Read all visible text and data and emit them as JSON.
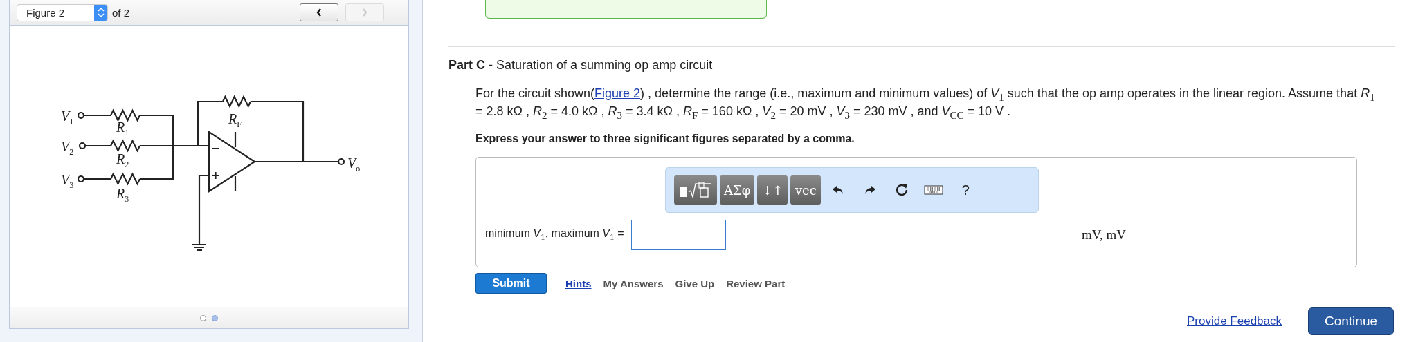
{
  "figure_nav": {
    "select_value": "Figure 2",
    "count": "of 2",
    "prev_disabled": false,
    "next_disabled": true
  },
  "circuit": {
    "labels": [
      {
        "base": "V",
        "sub": "1"
      },
      {
        "base": "V",
        "sub": "2"
      },
      {
        "base": "V",
        "sub": "3"
      },
      {
        "base": "R",
        "sub": "1"
      },
      {
        "base": "R",
        "sub": "2"
      },
      {
        "base": "R",
        "sub": "3"
      },
      {
        "base": "R",
        "sub": "F"
      },
      {
        "base": "V",
        "sub": "o"
      }
    ]
  },
  "pager": [
    {
      "selected": false
    },
    {
      "selected": true
    }
  ],
  "part": {
    "label": "Part C -",
    "title": "Saturation of a summing op amp circuit"
  },
  "problem": {
    "before_link": "For the circuit shown(",
    "link": "Figure 2",
    "after_link": ") , determine the range (i.e., maximum and minimum values) of *V*$_{1}$ such that the op amp operates in the linear region. Assume that *R*$_{1}$ = 2.8 kΩ , *R*$_{2}$ = 4.0 kΩ , *R*$_{3}$ = 3.4 kΩ , *R*$_{F}$ = 160 kΩ , *V*$_{2}$ = 20 mV , *V*$_{3}$ = 230 mV , and *V*$_{CC}$ = 10 V ."
  },
  "instruction": "Express your answer to three significant figures separated by a comma.",
  "toolbar": [
    {
      "kind": "template"
    },
    {
      "kind": "text",
      "label": "ΑΣφ"
    },
    {
      "kind": "text",
      "label": "↓↑"
    },
    {
      "kind": "text",
      "label": "vec"
    },
    {
      "kind": "undo"
    },
    {
      "kind": "redo"
    },
    {
      "kind": "reset"
    },
    {
      "kind": "keyboard"
    },
    {
      "kind": "help",
      "label": "?"
    }
  ],
  "answer": {
    "label": "minimum *V*$_{1}$, maximum *V*$_{1}$ =",
    "units": "mV, mV"
  },
  "submit": "Submit",
  "actions": [
    {
      "label": "Hints",
      "kind": "link"
    },
    {
      "label": "My Answers",
      "kind": "action"
    },
    {
      "label": "Give Up",
      "kind": "action"
    },
    {
      "label": "Review Part",
      "kind": "action"
    }
  ],
  "footer": {
    "feedback": "Provide Feedback",
    "continue": "Continue"
  }
}
